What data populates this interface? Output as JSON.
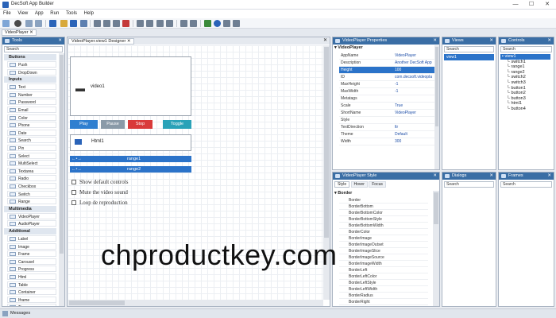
{
  "app": {
    "title": "DecSoft App Builder"
  },
  "window_controls": {
    "minimize": "—",
    "maximize": "☐",
    "close": "✕"
  },
  "menu": [
    "File",
    "View",
    "App",
    "Run",
    "Tools",
    "Help"
  ],
  "doc_tabs": [
    "VideoPlayer"
  ],
  "tools_panel": {
    "title": "Tools",
    "search": "Search",
    "categories": [
      {
        "name": "Buttons",
        "items": [
          "Push",
          "DropDown"
        ]
      },
      {
        "name": "Inputs",
        "items": [
          "Text",
          "Number",
          "Password",
          "Email",
          "Color",
          "Phone",
          "Date",
          "Search",
          "Pin",
          "Select",
          "MultiSelect",
          "Textarea",
          "Radio",
          "Checkbox",
          "Switch",
          "Range"
        ]
      },
      {
        "name": "Multimedia",
        "items": [
          "VideoPlayer",
          "AudioPlayer"
        ]
      },
      {
        "name": "Additional",
        "items": [
          "Label",
          "Image",
          "Frame",
          "Carousel",
          "Progress",
          "Html",
          "Table",
          "Container",
          "Iframe",
          "Timer"
        ]
      }
    ]
  },
  "designer": {
    "tab": "VideoPlayer.view1 Designer",
    "video_label": "video1",
    "buttons": [
      {
        "label": "Play",
        "color": "#2f7fd0"
      },
      {
        "label": "Pause",
        "color": "#8a9aa8"
      },
      {
        "label": "Stop",
        "color": "#d93a3a"
      },
      {
        "label": "Toggle",
        "color": "#2aa2b8"
      }
    ],
    "html_label": "Html1",
    "ranges": [
      "range1",
      "range2"
    ],
    "checks": [
      "Show default controls",
      "Mute the video sound",
      "Loop de reproduction"
    ]
  },
  "properties_panel": {
    "title": "VideoPlayer Properties",
    "section": "VideoPlayer",
    "rows": [
      {
        "k": "AppName",
        "v": "VideoPlayer"
      },
      {
        "k": "Description",
        "v": "Another DecSoft App"
      },
      {
        "k": "Height",
        "v": "100"
      },
      {
        "k": "ID",
        "v": "com.decsoft.videopla"
      },
      {
        "k": "MaxHeight",
        "v": "-1"
      },
      {
        "k": "MaxWidth",
        "v": "-1"
      },
      {
        "k": "Metatags",
        "v": ""
      },
      {
        "k": "Scale",
        "v": "True"
      },
      {
        "k": "ShortName",
        "v": "VideoPlayer"
      },
      {
        "k": "Style",
        "v": ""
      },
      {
        "k": "TextDirection",
        "v": "ltr"
      },
      {
        "k": "Theme",
        "v": "Default"
      },
      {
        "k": "Width",
        "v": "300"
      }
    ]
  },
  "style_panel": {
    "title": "VideoPlayer Style",
    "tabs": [
      "Style",
      "Hover",
      "Focus"
    ],
    "section": "Border",
    "rows": [
      "Border",
      "BorderBottom",
      "BorderBottomColor",
      "BorderBottomStyle",
      "BorderBottomWidth",
      "BorderColor",
      "BorderImage",
      "BorderImageOutset",
      "BorderImageSlice",
      "BorderImageSource",
      "BorderImageWidth",
      "BorderLeft",
      "BorderLeftColor",
      "BorderLeftStyle",
      "BorderLeftWidth",
      "BorderRadius",
      "BorderRight"
    ]
  },
  "views_panel": {
    "title": "Views",
    "items": [
      "view1"
    ],
    "search": "Search"
  },
  "controls_panel": {
    "title": "Controls",
    "search": "Search",
    "items": [
      "view1",
      "switch1",
      "range1",
      "range2",
      "switch2",
      "switch3",
      "button1",
      "button2",
      "button3",
      "html1",
      "button4"
    ]
  },
  "dialogs_panel": {
    "title": "Dialogs",
    "search": "Search"
  },
  "frames_panel": {
    "title": "Frames",
    "search": "Search"
  },
  "watermark": "chproductkey.com",
  "status": {
    "label": "Messages"
  }
}
